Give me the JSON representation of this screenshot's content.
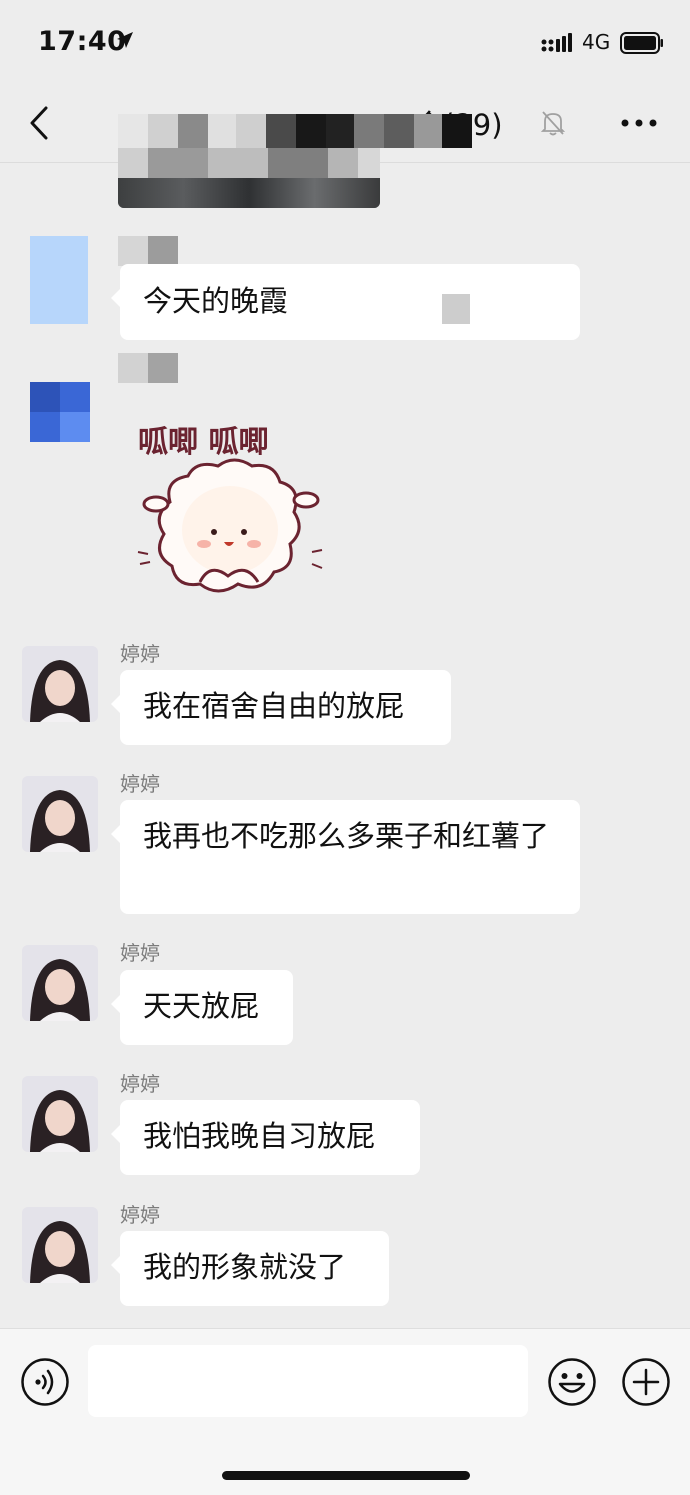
{
  "status_bar": {
    "time": "17:40",
    "network": "4G"
  },
  "nav": {
    "title": "令(29)"
  },
  "messages": [
    {
      "sender": "",
      "text": "今天的晚霞"
    },
    {
      "sender": "",
      "sticker_text": "呱唧 呱唧"
    },
    {
      "sender": "婷婷",
      "text": "我在宿舍自由的放屁"
    },
    {
      "sender": "婷婷",
      "text": "我再也不吃那么多栗子和红薯了"
    },
    {
      "sender": "婷婷",
      "text": "天天放屁"
    },
    {
      "sender": "婷婷",
      "text": "我怕我晚自习放屁"
    },
    {
      "sender": "婷婷",
      "text": "我的形象就没了"
    }
  ],
  "input": {
    "placeholder": ""
  },
  "colors": {
    "background": "#ededed",
    "bubble": "#ffffff",
    "sender_name": "#7c7c7c"
  },
  "icons": [
    "location-arrow-icon",
    "signal-icon",
    "battery-icon",
    "back-icon",
    "mute-bell-icon",
    "more-icon",
    "voice-icon",
    "emoji-icon",
    "plus-icon"
  ]
}
